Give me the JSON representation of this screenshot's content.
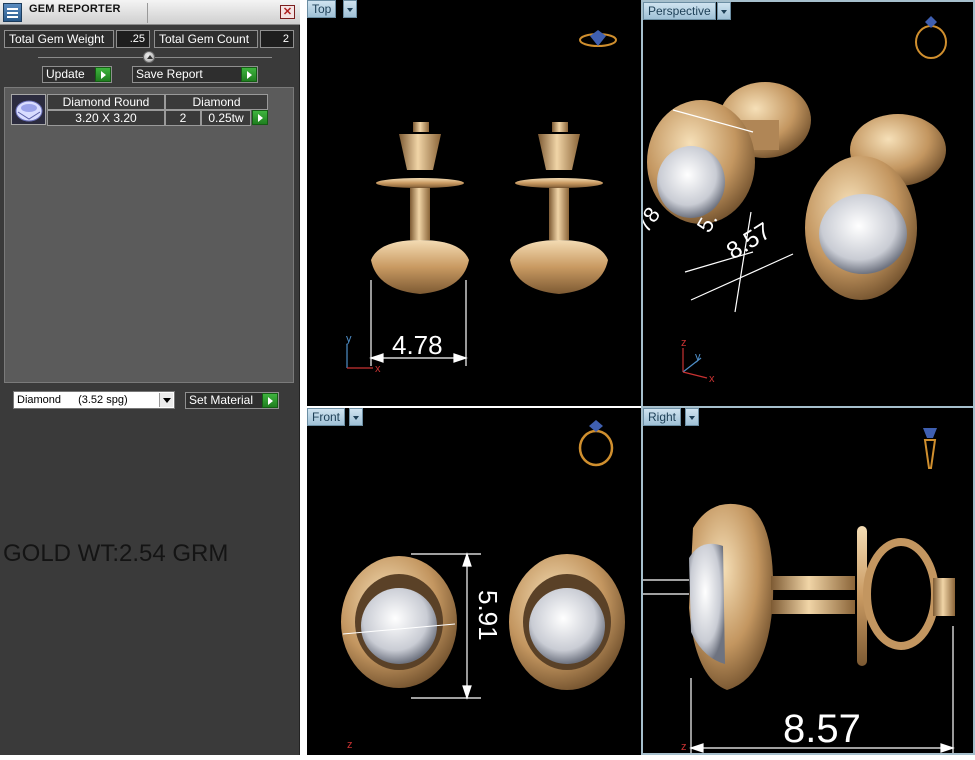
{
  "window": {
    "title": "GEM REPORTER",
    "close_glyph": "✕"
  },
  "stats": {
    "total_weight_label": "Total Gem Weight",
    "total_weight_value": ".25",
    "total_count_label": "Total Gem Count",
    "total_count_value": "2"
  },
  "actions": {
    "update_label": "Update",
    "save_report_label": "Save Report"
  },
  "gem_table": {
    "rows": [
      {
        "shape": "Diamond Round",
        "size": "3.20 X 3.20",
        "material": "Diamond",
        "count": "2",
        "weight": "0.25tw"
      }
    ]
  },
  "material": {
    "name": "Diamond",
    "spec": "(3.52 spg)",
    "set_label": "Set Material"
  },
  "annotation": {
    "gold_weight": "GOLD WT:2.54 GRM"
  },
  "viewports": {
    "top": {
      "label": "Top",
      "dimension": "4.78",
      "axis_y": "y",
      "axis_x": "x"
    },
    "perspective": {
      "label": "Perspective",
      "dim_1": "8.57",
      "dim_2": "5.",
      "dim_3": "78",
      "axis_z": "z",
      "axis_y": "y",
      "axis_x": "x"
    },
    "front": {
      "label": "Front",
      "dimension": "5.91",
      "axis_z": "z"
    },
    "right": {
      "label": "Right",
      "dimension": "8.57",
      "axis_z": "z"
    }
  },
  "colors": {
    "panel_bg": "#3a3a3a",
    "gold": "#d6b27e",
    "viewport_label_bg": "#b7d3e4",
    "green_button": "#2e9b2e"
  },
  "icons": {
    "app": "gem-reporter-icon",
    "close": "close-icon",
    "collapse": "collapse-arrow-icon",
    "update_arrow": "play-arrow-icon",
    "dropdown": "dropdown-arrow-icon"
  }
}
